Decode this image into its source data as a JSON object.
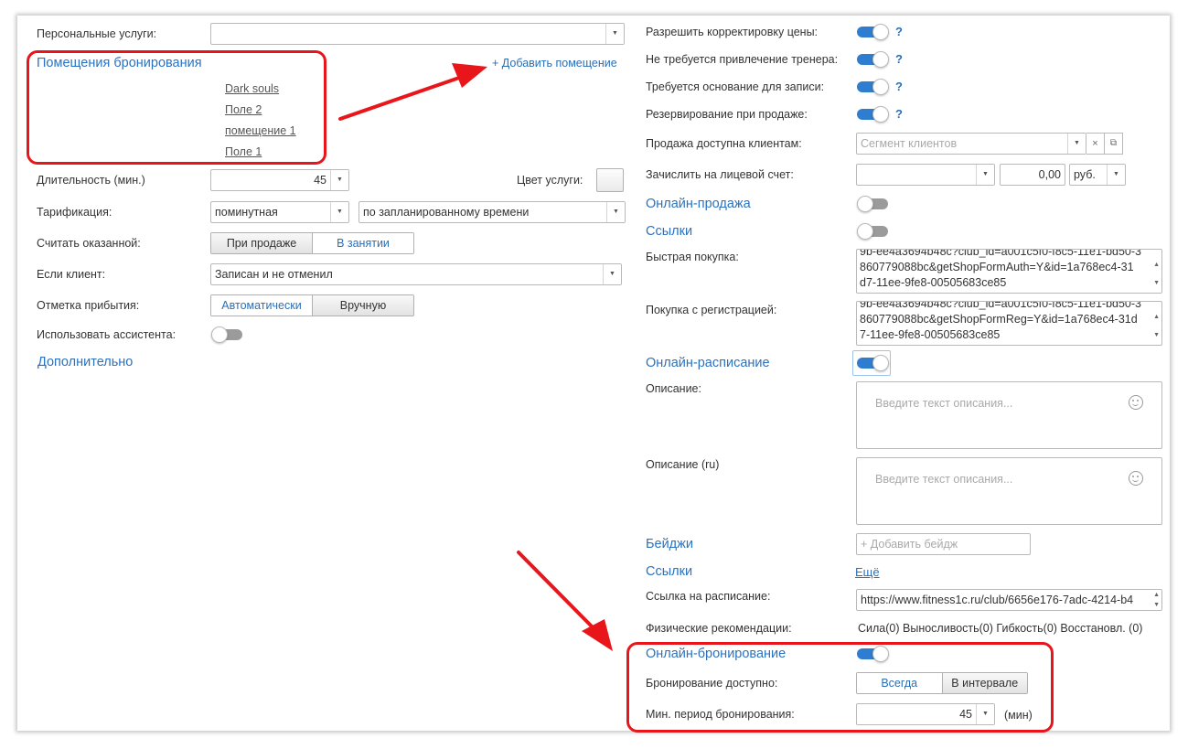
{
  "left": {
    "personal_services_label": "Персональные услуги:",
    "booking_rooms_title": "Помещения бронирования",
    "add_room_link": "+ Добавить помещение",
    "rooms": [
      "Dark souls",
      "Поле 2",
      "помещение 1",
      "Поле 1"
    ],
    "duration_label": "Длительность (мин.)",
    "duration_value": "45",
    "service_color_label": "Цвет услуги:",
    "tariff_label": "Тарификация:",
    "tariff_value": "поминутная",
    "tariff_mode_value": "по запланированному времени",
    "count_done_label": "Считать оказанной:",
    "count_done_options": [
      "При продаже",
      "В занятии"
    ],
    "count_done_selected": "В занятии",
    "if_client_label": "Если клиент:",
    "if_client_value": "Записан и не отменил",
    "arrival_label": "Отметка прибытия:",
    "arrival_options": [
      "Автоматически",
      "Вручную"
    ],
    "arrival_selected": "Автоматически",
    "assistant_label": "Использовать ассистента:",
    "assistant_on": false,
    "more_link": "Дополнительно"
  },
  "right": {
    "allow_price_label": "Разрешить корректировку цены:",
    "no_trainer_label": "Не требуется привлечение тренера:",
    "basis_label": "Требуется основание для записи:",
    "reserve_label": "Резервирование при продаже:",
    "help": "?",
    "sale_clients_label": "Продажа доступна клиентам:",
    "segment_placeholder": "Сегмент клиентов",
    "account_label": "Зачислить на лицевой счет:",
    "account_amount": "0,00",
    "currency": "руб.",
    "online_sale_title": "Онлайн-продажа",
    "links_title": "Ссылки",
    "quick_buy_label": "Быстрая покупка:",
    "quick_buy_lines": [
      "9b-ee4a3694b48c?club_id=a001c5f0-f8c5-11e1-bd50-3",
      "860779088bc&getShopFormAuth=Y&id=1a768ec4-31",
      "d7-11ee-9fe8-00505683ce85"
    ],
    "reg_buy_label": "Покупка с регистрацией:",
    "reg_buy_lines": [
      "9b-ee4a3694b48c?club_id=a001c5f0-f8c5-11e1-bd50-3",
      "860779088bc&getShopFormReg=Y&id=1a768ec4-31d",
      "7-11ee-9fe8-00505683ce85"
    ],
    "online_schedule_title": "Онлайн-расписание",
    "description_label": "Описание:",
    "description_placeholder": "Введите текст описания...",
    "description_ru_label": "Описание (ru)",
    "badges_title": "Бейджи",
    "add_badge_placeholder": "+ Добавить бейдж",
    "links2_title": "Ссылки",
    "more_link": "Ещё",
    "schedule_link_label": "Ссылка на расписание:",
    "schedule_link_value": "https://www.fitness1c.ru/club/6656e176-7adc-4214-b4",
    "phys_label": "Физические рекомендации:",
    "phys_value": "Сила(0) Выносливость(0) Гибкость(0) Восстановл. (0)",
    "online_booking_title": "Онлайн-бронирование",
    "booking_available_label": "Бронирование доступно:",
    "booking_options": [
      "Всегда",
      "В интервале"
    ],
    "booking_selected": "Всегда",
    "min_period_label": "Мин. период бронирования:",
    "min_period_value": "45",
    "min_period_unit": "(мин)",
    "toggles": {
      "allow_price": true,
      "no_trainer": true,
      "basis": true,
      "reserve": true,
      "online_sale": false,
      "links": false,
      "online_schedule": true,
      "online_booking": true
    }
  },
  "colors": {
    "accent": "#2f7dd1",
    "link": "#2b72c0",
    "annotation": "#e8161b"
  }
}
